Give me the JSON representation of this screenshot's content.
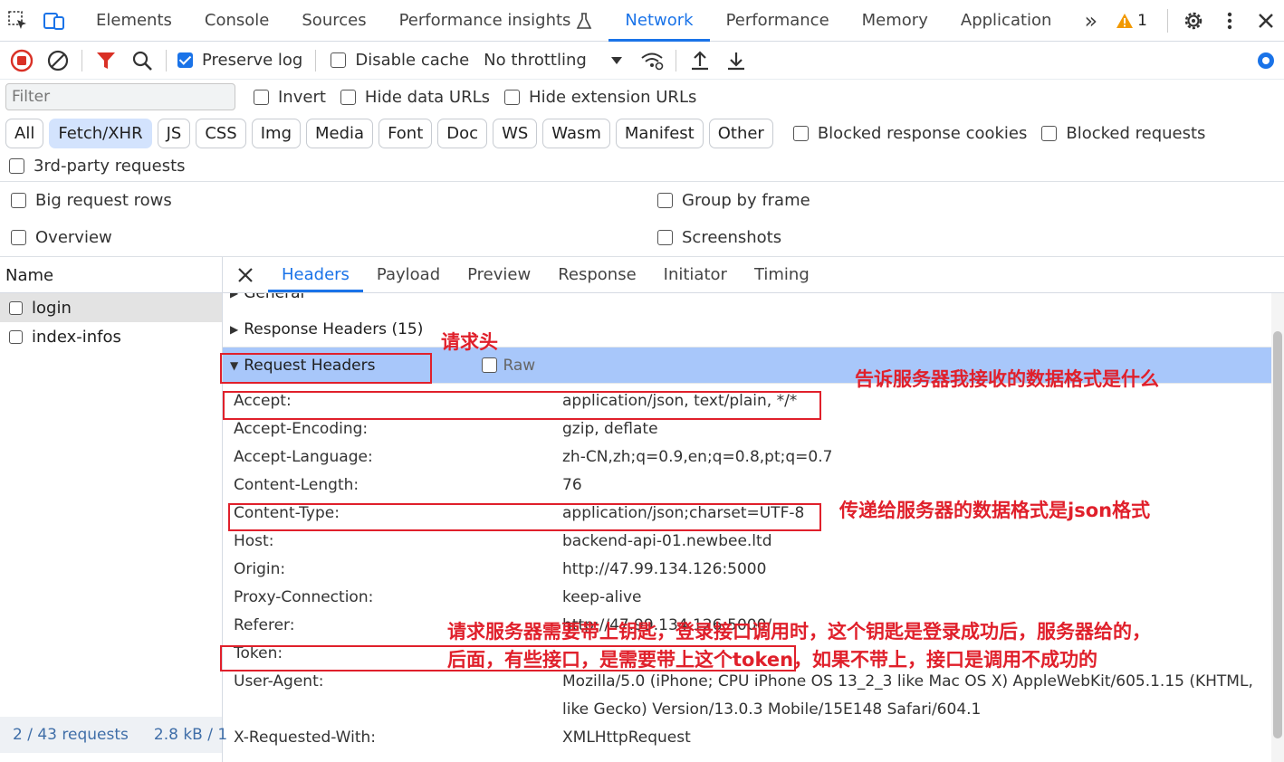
{
  "topbar": {
    "tabs": [
      "Elements",
      "Console",
      "Sources",
      "Performance insights",
      "Network",
      "Performance",
      "Memory",
      "Application"
    ],
    "active_tab": "Network",
    "more": "»",
    "warning_count": "1"
  },
  "toolbar": {
    "preserve_log": "Preserve log",
    "disable_cache": "Disable cache",
    "throttling": "No throttling"
  },
  "filter": {
    "placeholder": "Filter",
    "invert": "Invert",
    "hide_data_urls": "Hide data URLs",
    "hide_extension_urls": "Hide extension URLs"
  },
  "type_chips": [
    "All",
    "Fetch/XHR",
    "JS",
    "CSS",
    "Img",
    "Media",
    "Font",
    "Doc",
    "WS",
    "Wasm",
    "Manifest",
    "Other"
  ],
  "selected_chip": "Fetch/XHR",
  "extra_filters": {
    "blocked_cookies": "Blocked response cookies",
    "blocked_requests": "Blocked requests",
    "third_party": "3rd-party requests"
  },
  "settings": {
    "big_rows": "Big request rows",
    "group_by_frame": "Group by frame",
    "overview": "Overview",
    "screenshots": "Screenshots"
  },
  "requests": {
    "column": "Name",
    "items": [
      "login",
      "index-infos"
    ],
    "footer_count": "2 / 43 requests",
    "footer_size": "2.8 kB / 1"
  },
  "detail": {
    "tabs": [
      "Headers",
      "Payload",
      "Preview",
      "Response",
      "Initiator",
      "Timing"
    ],
    "active_tab": "Headers",
    "general": "General",
    "response_headers": "Response Headers (15)",
    "request_headers": "Request Headers",
    "raw": "Raw",
    "headers": [
      {
        "name": "Accept:",
        "value": "application/json, text/plain, */*"
      },
      {
        "name": "Accept-Encoding:",
        "value": "gzip, deflate"
      },
      {
        "name": "Accept-Language:",
        "value": "zh-CN,zh;q=0.9,en;q=0.8,pt;q=0.7"
      },
      {
        "name": "Content-Length:",
        "value": "76"
      },
      {
        "name": "Content-Type:",
        "value": "application/json;charset=UTF-8"
      },
      {
        "name": "Host:",
        "value": "backend-api-01.newbee.ltd"
      },
      {
        "name": "Origin:",
        "value": "http://47.99.134.126:5000"
      },
      {
        "name": "Proxy-Connection:",
        "value": "keep-alive"
      },
      {
        "name": "Referer:",
        "value": "http://47.99.134.126:5000/"
      },
      {
        "name": "Token:",
        "value": ""
      },
      {
        "name": "User-Agent:",
        "value": "Mozilla/5.0 (iPhone; CPU iPhone OS 13_2_3 like Mac OS X) AppleWebKit/605.1.15 (KHTML, like Gecko) Version/13.0.3 Mobile/15E148 Safari/604.1"
      },
      {
        "name": "X-Requested-With:",
        "value": "XMLHttpRequest"
      }
    ]
  },
  "annotations": {
    "request_header": "请求头",
    "accept_note": "告诉服务器我接收的数据格式是什么",
    "content_type_note": "传递给服务器的数据格式是json格式",
    "token_note_1": "请求服务器需要带上钥匙，登录接口调用时，这个钥匙是登录成功后，服务器给的，",
    "token_note_2": "后面，有些接口，是需要带上这个token，如果不带上，接口是调用不成功的"
  },
  "colors": {
    "accent": "#1a73e8",
    "annotation_red": "#e0202b",
    "selected_row": "#a8c7fa"
  }
}
